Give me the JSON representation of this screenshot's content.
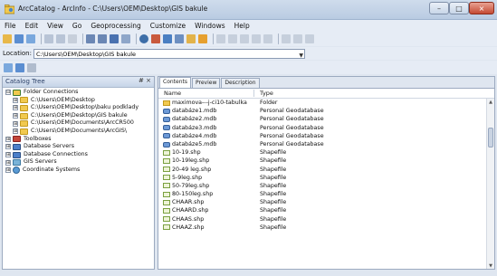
{
  "window": {
    "title": "ArcCatalog - ArcInfo - C:\\Users\\OEM\\Desktop\\GIS bakule",
    "controls": {
      "minimize": "–",
      "maximize": "□",
      "close": "×"
    }
  },
  "menu": [
    "File",
    "Edit",
    "View",
    "Go",
    "Geoprocessing",
    "Customize",
    "Windows",
    "Help"
  ],
  "location": {
    "label": "Location:",
    "value": "C:\\Users\\OEM\\Desktop\\GIS bakule"
  },
  "catalog_tree": {
    "title": "Catalog Tree",
    "controls": "# ×",
    "items": [
      {
        "label": "Folder Connections",
        "expander": "⊟",
        "icon": "folder-connections-icon"
      },
      {
        "label": "C:\\Users\\OEM\\Desktop",
        "expander": "⊞",
        "icon": "folder-icon"
      },
      {
        "label": "C:\\Users\\OEM\\Desktop\\baku podklady",
        "expander": "⊞",
        "icon": "folder-icon"
      },
      {
        "label": "C:\\Users\\OEM\\Desktop\\GIS bakule",
        "expander": "⊞",
        "icon": "folder-icon"
      },
      {
        "label": "C:\\Users\\OEM\\Documents\\ArcCR500",
        "expander": "⊞",
        "icon": "folder-icon"
      },
      {
        "label": "C:\\Users\\OEM\\Documents\\ArcGIS\\",
        "expander": "⊞",
        "icon": "folder-icon"
      },
      {
        "label": "Toolboxes",
        "expander": "⊞",
        "icon": "toolbox-icon"
      },
      {
        "label": "Database Servers",
        "expander": "⊞",
        "icon": "database-server-icon"
      },
      {
        "label": "Database Connections",
        "expander": "⊞",
        "icon": "database-connection-icon"
      },
      {
        "label": "GIS Servers",
        "expander": "⊞",
        "icon": "gis-server-icon"
      },
      {
        "label": "Coordinate Systems",
        "expander": "⊞",
        "icon": "globe-icon"
      }
    ]
  },
  "tabs": [
    "Contents",
    "Preview",
    "Description"
  ],
  "contents": {
    "headers": {
      "name": "Name",
      "type": "Type"
    },
    "rows": [
      {
        "name": "maximova---j-ci10-tabulka",
        "type": "Folder",
        "icon": "folder-icon"
      },
      {
        "name": "databáze1.mdb",
        "type": "Personal Geodatabase",
        "icon": "geodatabase-icon"
      },
      {
        "name": "databáze2.mdb",
        "type": "Personal Geodatabase",
        "icon": "geodatabase-icon"
      },
      {
        "name": "databáze3.mdb",
        "type": "Personal Geodatabase",
        "icon": "geodatabase-icon"
      },
      {
        "name": "databáze4.mdb",
        "type": "Personal Geodatabase",
        "icon": "geodatabase-icon"
      },
      {
        "name": "databáze5.mdb",
        "type": "Personal Geodatabase",
        "icon": "geodatabase-icon"
      },
      {
        "name": "10-19.shp",
        "type": "Shapefile",
        "icon": "shapefile-icon"
      },
      {
        "name": "10-19leg.shp",
        "type": "Shapefile",
        "icon": "shapefile-icon"
      },
      {
        "name": "20-49 leg.shp",
        "type": "Shapefile",
        "icon": "shapefile-icon"
      },
      {
        "name": "5-9leg.shp",
        "type": "Shapefile",
        "icon": "shapefile-icon"
      },
      {
        "name": "50-79leg.shp",
        "type": "Shapefile",
        "icon": "shapefile-icon"
      },
      {
        "name": "80-150leg.shp",
        "type": "Shapefile",
        "icon": "shapefile-icon"
      },
      {
        "name": "CHAAR.shp",
        "type": "Shapefile",
        "icon": "shapefile-icon"
      },
      {
        "name": "CHAARD.shp",
        "type": "Shapefile",
        "icon": "shapefile-icon"
      },
      {
        "name": "CHAAS.shp",
        "type": "Shapefile",
        "icon": "shapefile-icon"
      },
      {
        "name": "CHAAZ.shp",
        "type": "Shapefile",
        "icon": "shapefile-icon"
      }
    ]
  },
  "scrollbar": {
    "up": "▲",
    "down": "▼"
  }
}
